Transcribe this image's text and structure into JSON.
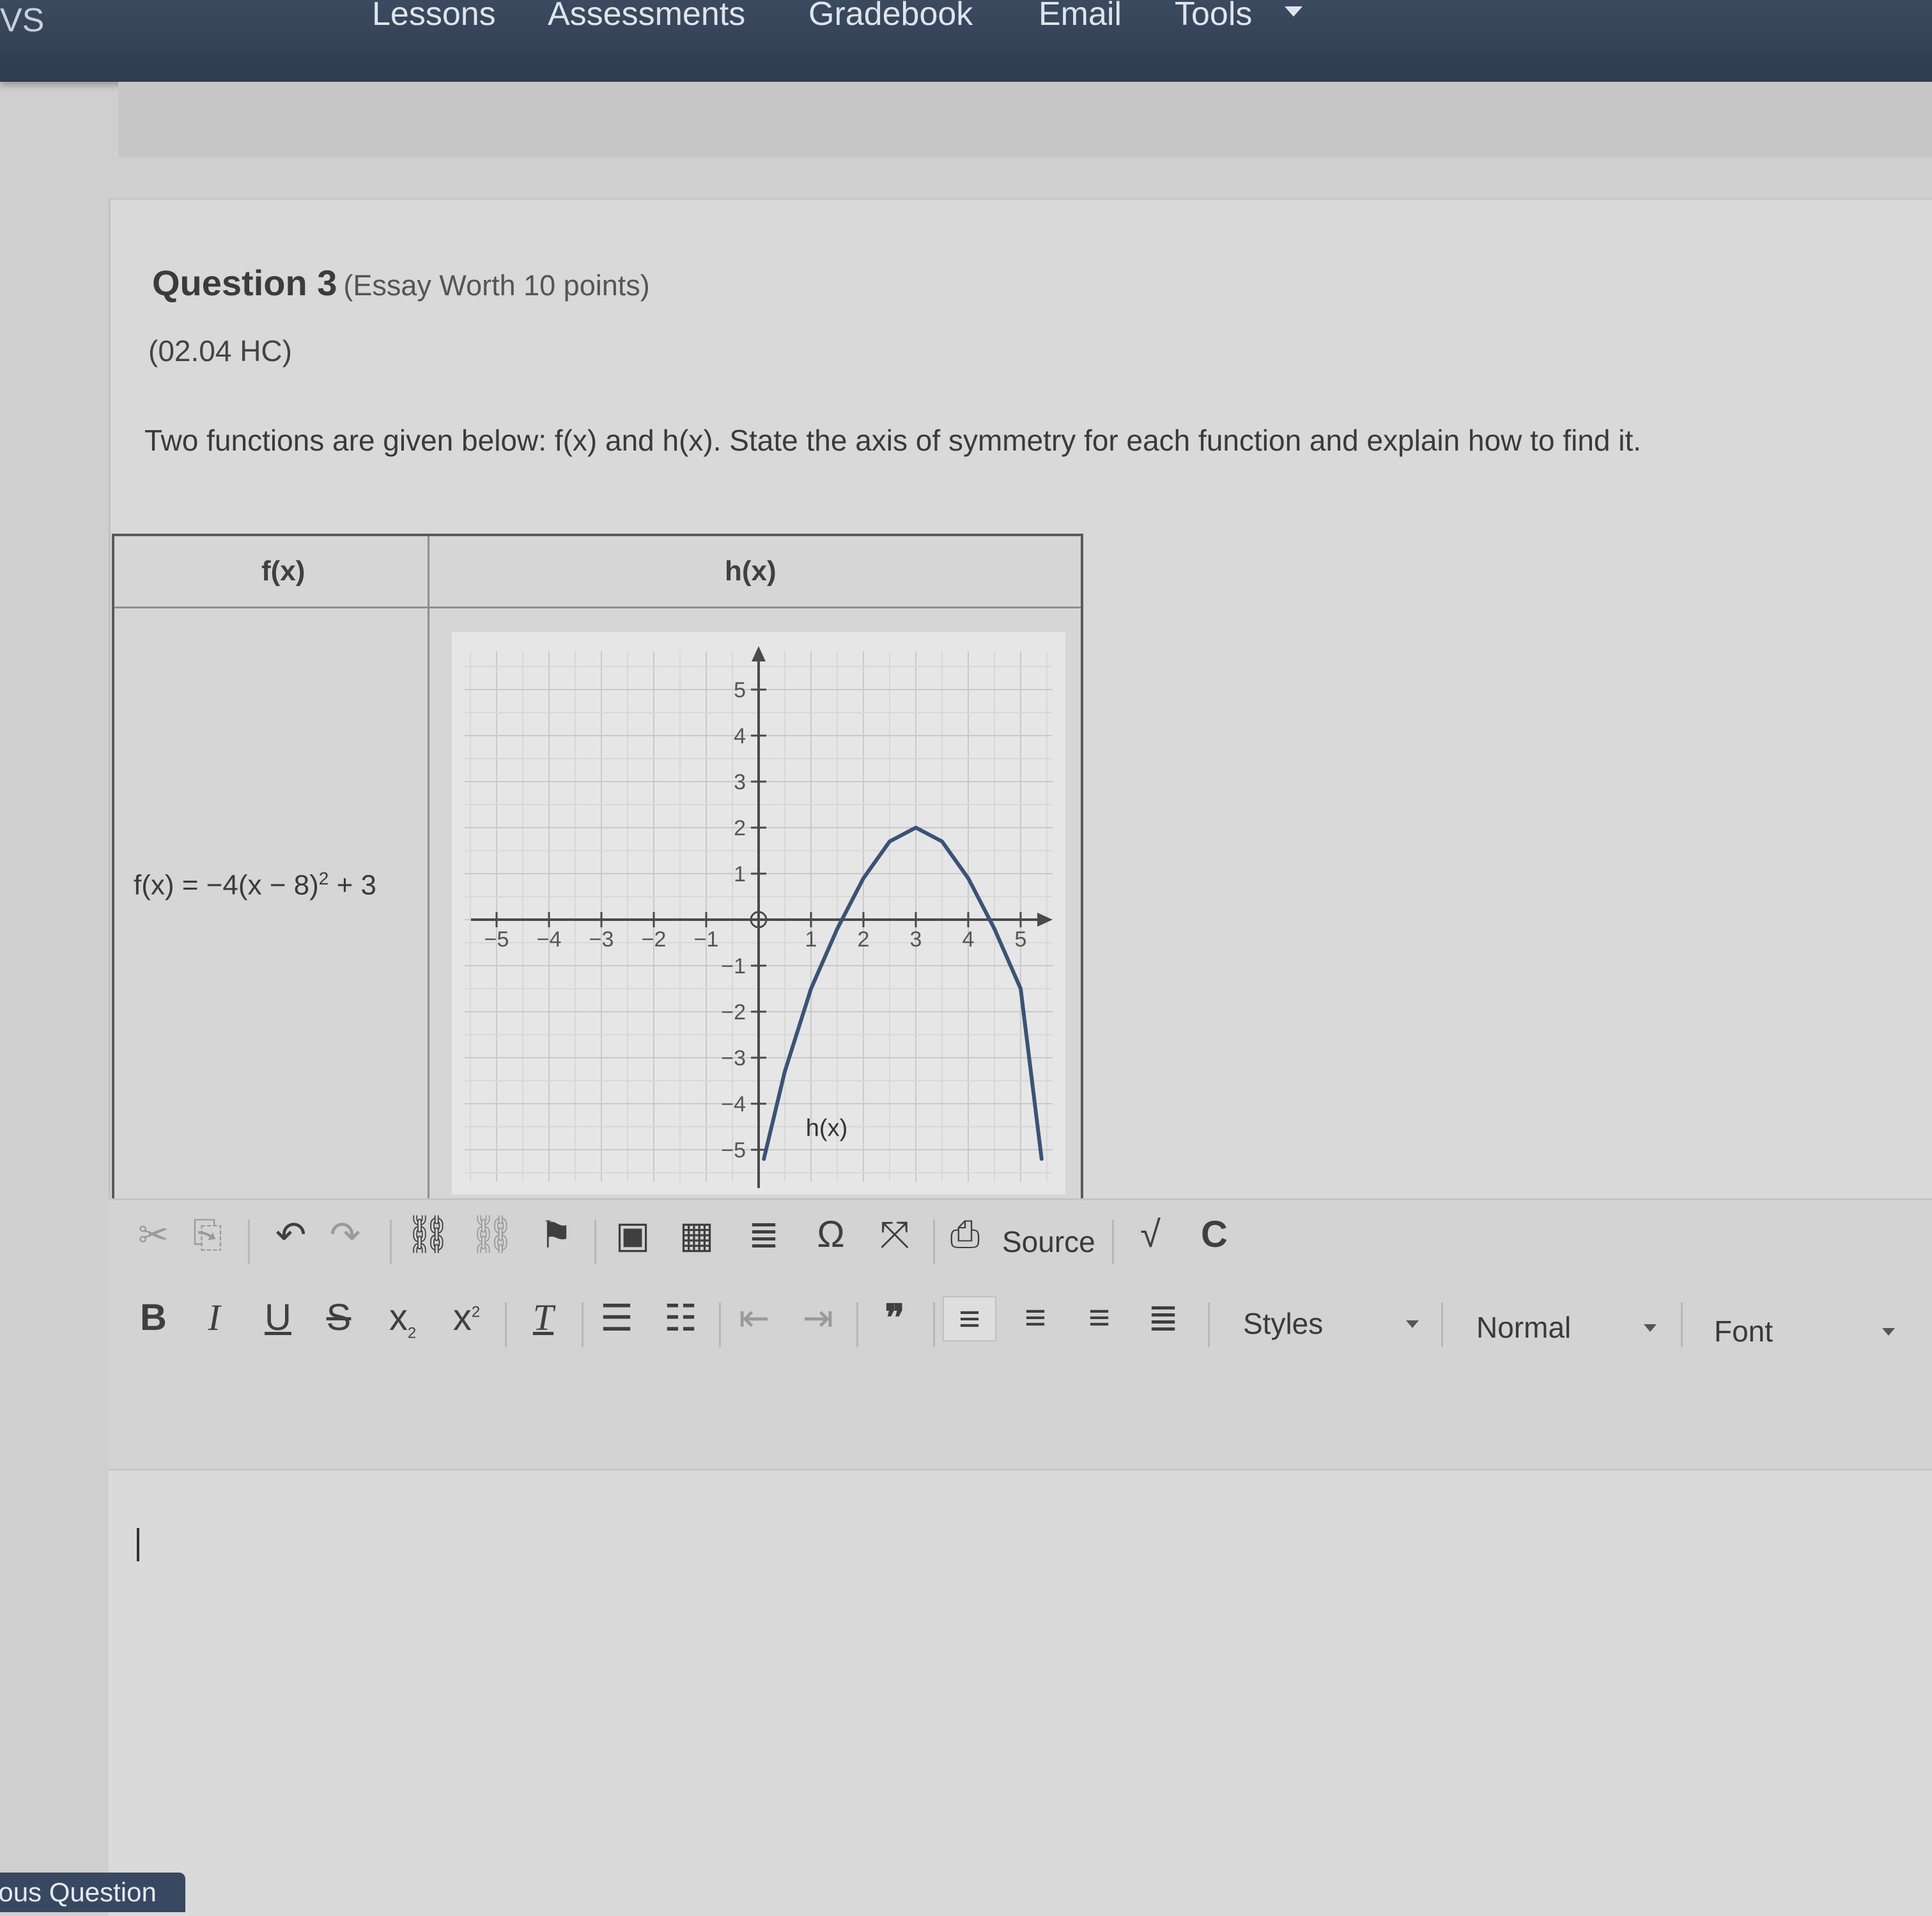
{
  "nav": {
    "brand": "VS",
    "items": [
      "Lessons",
      "Assessments",
      "Gradebook",
      "Email",
      "Tools"
    ]
  },
  "question": {
    "title": "Question 3",
    "worth": "(Essay Worth 10 points)",
    "code": "(02.04 HC)",
    "prompt": "Two functions are given below: f(x) and h(x). State the axis of symmetry for each function and explain how to find it."
  },
  "table": {
    "col_f": "f(x)",
    "col_h": "h(x)",
    "f_formula_prefix": "f(x) = −4(x − 8)",
    "f_formula_exp": "2",
    "f_formula_suffix": " + 3"
  },
  "chart_data": {
    "type": "line",
    "xlim": [
      -5,
      5
    ],
    "ylim": [
      -5,
      5
    ],
    "x_ticks": [
      -5,
      -4,
      -3,
      -2,
      -1,
      1,
      2,
      3,
      4,
      5
    ],
    "y_ticks": [
      -5,
      -4,
      -3,
      -2,
      -1,
      1,
      2,
      3,
      4,
      5
    ],
    "grid": true,
    "series": [
      {
        "name": "h(x)",
        "x": [
          0.1,
          0.5,
          1.0,
          1.5,
          2.0,
          2.5,
          3.0,
          3.5,
          4.0,
          4.5,
          5.0,
          5.4
        ],
        "y": [
          -5.2,
          -3.3,
          -1.5,
          -0.2,
          0.9,
          1.7,
          2.0,
          1.7,
          0.9,
          -0.2,
          -1.5,
          -5.2
        ]
      }
    ],
    "curve_label": "h(x)"
  },
  "editor": {
    "source_label": "Source",
    "styles_label": "Styles",
    "format_label": "Normal",
    "font_label": "Font",
    "bold": "B",
    "italic": "I",
    "underline": "U",
    "strike": "S",
    "subscript": "x",
    "superscript": "x"
  },
  "footer": {
    "prev_label": "ious Question"
  },
  "colors": {
    "nav_bg": "#33405a",
    "curve": "#3c5275"
  }
}
